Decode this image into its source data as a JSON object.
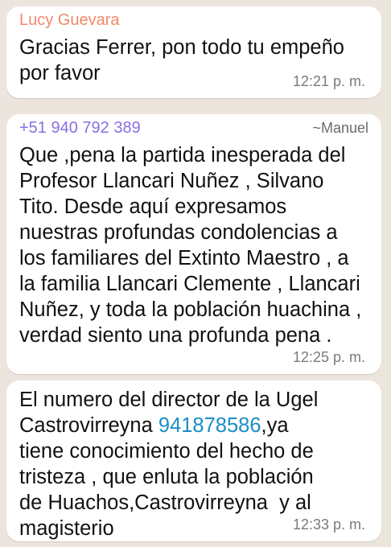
{
  "messages": [
    {
      "sender": "Lucy Guevara",
      "sender_color": "#f08a6a",
      "text": "Gracias Ferrer, pon todo tu empeño\npor favor",
      "time": "12:21 p. m."
    },
    {
      "sender": "+51 940 792 389",
      "sender_color": "#8a6ee6",
      "alias": "~Manuel",
      "text": "Que ,pena la partida inesperada del\nProfesor Llancari Nuñez , Silvano\nTito. Desde aquí expresamos\nnuestras profundas condolencias a\nlos familiares del Extinto Maestro , a\nla familia Llancari Clemente , Llancari\nNuñez, y toda la población huachina ,\nverdad siento una profunda pena .",
      "time": "12:25 p. m."
    },
    {
      "text_before": "El numero del director de la Ugel\nCastrovirreyna ",
      "phone": "941878586",
      "text_after": ",ya\ntiene conocimiento del hecho de\ntristeza , que enluta la población\nde Huachos,Castrovirreyna  y al\nmagisterio",
      "time": "12:33 p. m."
    }
  ]
}
